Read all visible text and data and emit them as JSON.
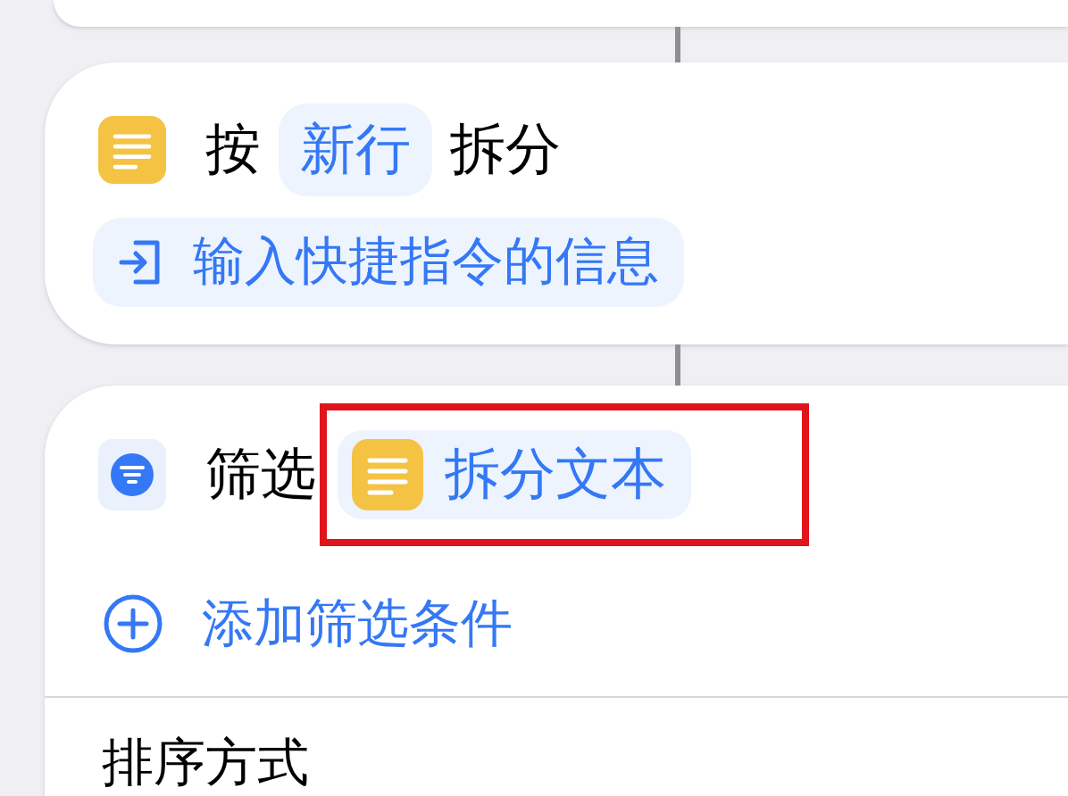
{
  "split_action": {
    "prefix": "按",
    "separator": "新行",
    "suffix": "拆分",
    "input": "输入快捷指令的信息"
  },
  "filter_action": {
    "label": "筛选",
    "variable": {
      "label": "拆分文本",
      "highlighted": true
    },
    "add_condition": "添加筛选条件",
    "sort_label": "排序方式"
  }
}
